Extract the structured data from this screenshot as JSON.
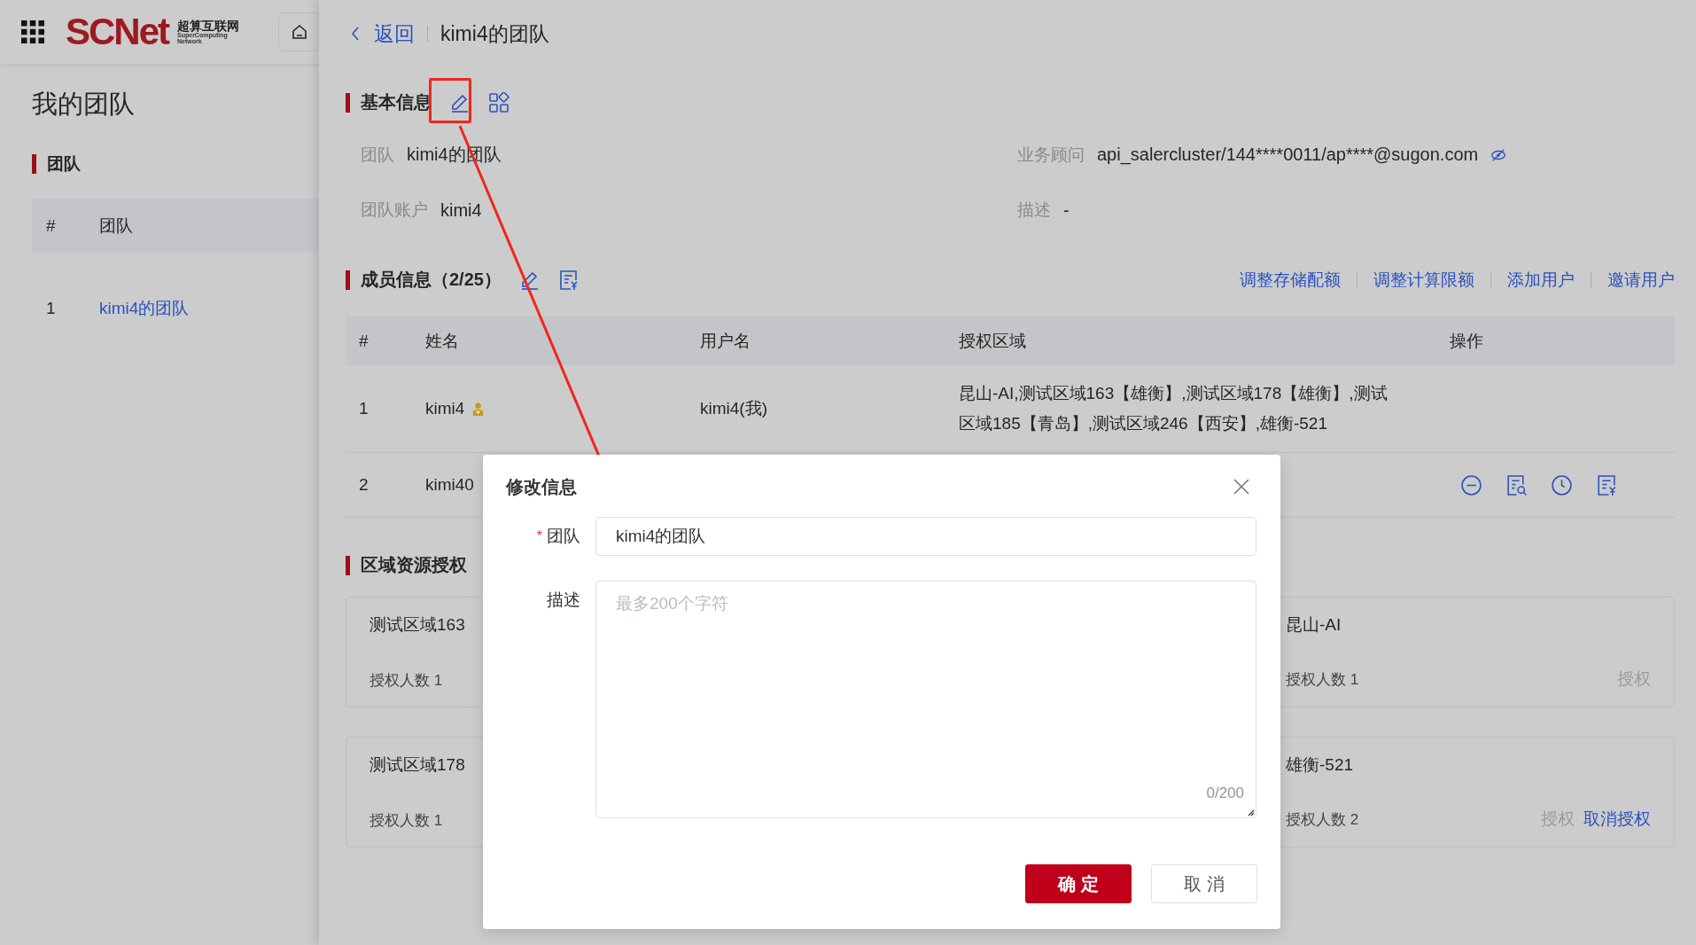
{
  "header": {
    "logo": "SCNet",
    "logo_cn": "超算互联网",
    "logo_en": [
      "SuperComputing",
      "Network"
    ]
  },
  "sidebar": {
    "title": "我的团队",
    "section": "团队",
    "columns": [
      "#",
      "团队"
    ],
    "rows": [
      {
        "index": "1",
        "team": "kimi4的团队"
      }
    ]
  },
  "drawer": {
    "back": "返回",
    "title": "kimi4的团队",
    "basic": {
      "title": "基本信息",
      "rows": [
        [
          {
            "label": "团队",
            "value": "kimi4的团队",
            "masked": false
          },
          {
            "label": "业务顾问",
            "value": "api_salercluster/144****0011/ap****@sugon.com",
            "masked": true
          }
        ],
        [
          {
            "label": "团队账户",
            "value": "kimi4",
            "masked": false
          },
          {
            "label": "描述",
            "value": "-",
            "masked": false
          }
        ]
      ]
    },
    "members": {
      "title": "成员信息（2/25）",
      "actions": [
        "调整存储配额",
        "调整计算限额",
        "添加用户",
        "邀请用户"
      ],
      "columns": [
        "#",
        "姓名",
        "用户名",
        "授权区域",
        "操作"
      ],
      "rows": [
        {
          "index": "1",
          "name": "kimi4",
          "admin": true,
          "username": "kimi4(我)",
          "regions": "昆山-AI,测试区域163【雄衡】,测试区域178【雄衡】,测试区域185【青岛】,测试区域246【西安】,雄衡-521",
          "has_actions": false
        },
        {
          "index": "2",
          "name": "kimi40",
          "admin": false,
          "has_actions": true
        }
      ]
    },
    "regions": {
      "title": "区域资源授权",
      "left_column": [
        {
          "name": "测试区域163",
          "count": "授权人数 1"
        },
        {
          "name": "测试区域178",
          "count": "授权人数 1"
        }
      ],
      "right_column": [
        {
          "name": "昆山-AI",
          "count": "授权人数 1",
          "actions": [
            {
              "label": "授权",
              "disabled": true
            }
          ]
        },
        {
          "name": "雄衡-521",
          "count": "授权人数 2",
          "actions": [
            {
              "label": "授权",
              "disabled": true
            },
            {
              "label": "取消授权",
              "disabled": false
            }
          ]
        }
      ]
    }
  },
  "modal": {
    "title": "修改信息",
    "fields": [
      {
        "kind": "input",
        "label": "团队",
        "required_mark": "*",
        "value": "kimi4的团队"
      },
      {
        "kind": "textarea",
        "label": "描述",
        "placeholder": "最多200个字符",
        "counter": "0/200"
      }
    ],
    "buttons": [
      {
        "label": "确 定",
        "primary": true
      },
      {
        "label": "取 消",
        "primary": false
      }
    ]
  }
}
